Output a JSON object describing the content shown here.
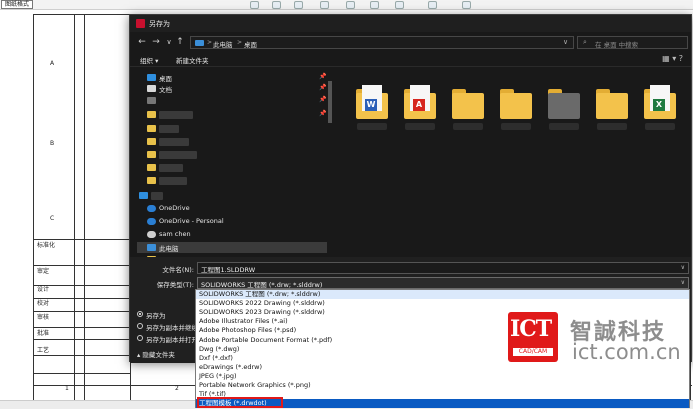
{
  "background": {
    "toolbar_tab": "图纸格式",
    "row_labels": [
      "A",
      "B",
      "C"
    ],
    "side_cells": [
      "标准化",
      "审定",
      "设计",
      "校对",
      "审核",
      "批准",
      "工艺"
    ],
    "column_markers": [
      "1",
      "2"
    ],
    "accent_red": "#e01919"
  },
  "dialog": {
    "title": "另存为",
    "nav": {
      "back": "←",
      "forward": "→",
      "down": "∨",
      "up": "↑",
      "refresh": "↻"
    },
    "address": {
      "crumbs": [
        "此电脑",
        "桌面"
      ],
      "separator": ">",
      "dropdown": "∨"
    },
    "search": {
      "icon": "⌕",
      "placeholder": "在 桌面 中搜索"
    },
    "commands": {
      "organize": "组织 ▾",
      "new_folder": "新建文件夹",
      "view": "▦ ▾  ?"
    },
    "sidebar": {
      "items": [
        {
          "label": "桌面",
          "pin": "📌",
          "icon": "desktop-folder-icon"
        },
        {
          "label": "文档",
          "pin": "📌",
          "icon": "documents-icon"
        },
        {
          "label": "",
          "pin": "📌",
          "icon": "blurred-folder-icon"
        },
        {
          "label": "",
          "pin": "📌",
          "icon": "blurred-folder-icon"
        },
        {
          "label": "",
          "pin": "",
          "icon": "blurred-folder-icon"
        },
        {
          "label": "",
          "pin": "",
          "icon": "blurred-folder-icon"
        },
        {
          "label": "",
          "pin": "",
          "icon": "blurred-folder-icon"
        },
        {
          "label": "",
          "pin": "",
          "icon": "blurred-folder-icon"
        },
        {
          "label": "",
          "pin": "",
          "icon": "blurred-folder-icon"
        },
        {
          "label": "",
          "pin": "",
          "icon": "blurred-folder-icon"
        },
        {
          "label": "OneDrive",
          "pin": "",
          "icon": "cloud-icon"
        },
        {
          "label": "OneDrive - Personal",
          "pin": "",
          "icon": "cloud-icon"
        },
        {
          "label": "sam chen",
          "pin": "",
          "icon": "user-icon"
        },
        {
          "label": "此电脑",
          "pin": "",
          "icon": "computer-icon"
        },
        {
          "label": "库",
          "pin": "",
          "icon": "library-icon"
        }
      ],
      "selected_index": 13
    },
    "form": {
      "filename_label": "文件名(N):",
      "filename_value": "工程图1.SLDDRW",
      "type_label": "保存类型(T):",
      "type_value": "SOLIDWORKS 工程图 (*.drw; *.slddrw)",
      "dropdown_arrow": "∨",
      "radios": [
        {
          "label": "另存为",
          "checked": true
        },
        {
          "label": "另存为副本并继续",
          "checked": false
        },
        {
          "label": "另存为副本并打开",
          "checked": false
        }
      ],
      "hide_folders": "▴ 隐藏文件夹"
    },
    "type_options": [
      "SOLIDWORKS 工程图 (*.drw; *.slddrw)",
      "SOLIDWORKS 2022 Drawing (*.slddrw)",
      "SOLIDWORKS 2023 Drawing (*.slddrw)",
      "Adobe Illustrator Files (*.ai)",
      "Adobe Photoshop Files (*.psd)",
      "Adobe Portable Document Format (*.pdf)",
      "Dwg (*.dwg)",
      "Dxf (*.dxf)",
      "eDrawings (*.edrw)",
      "JPEG (*.jpg)",
      "Portable Network Graphics (*.png)",
      "Tif (*.tif)",
      "工程图模板 (*.drwdot)"
    ],
    "type_selected_index": 12,
    "type_hover_index": 0
  },
  "watermark": {
    "logo_text": "ICT",
    "logo_sub": "CAD/CAM",
    "cn_text": "智誠科技",
    "url": "ict.com.cn"
  }
}
